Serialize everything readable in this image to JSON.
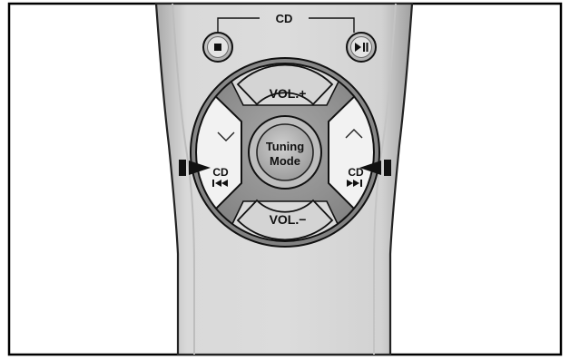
{
  "cd_group_label": "CD",
  "vol_up_label": "VOL.+",
  "vol_down_label": "VOL.−",
  "tuning_mode_line1": "Tuning",
  "tuning_mode_line2": "Mode",
  "left_cd_label": "CD",
  "right_cd_label": "CD",
  "icons": {
    "stop": "stop-icon",
    "play_pause": "play-pause-icon",
    "tune_down": "chevron-down-icon",
    "tune_up": "chevron-up-icon",
    "skip_back": "skip-back-icon",
    "skip_forward": "skip-forward-icon",
    "pointer_left": "pointer-arrow-right-icon",
    "pointer_right": "pointer-arrow-left-icon"
  },
  "colors": {
    "body": "#d6d6d6",
    "body_edge": "#b3b3b3",
    "ring": "#8e8e8e",
    "button": "#ececec",
    "outline": "#1a1a1a"
  }
}
